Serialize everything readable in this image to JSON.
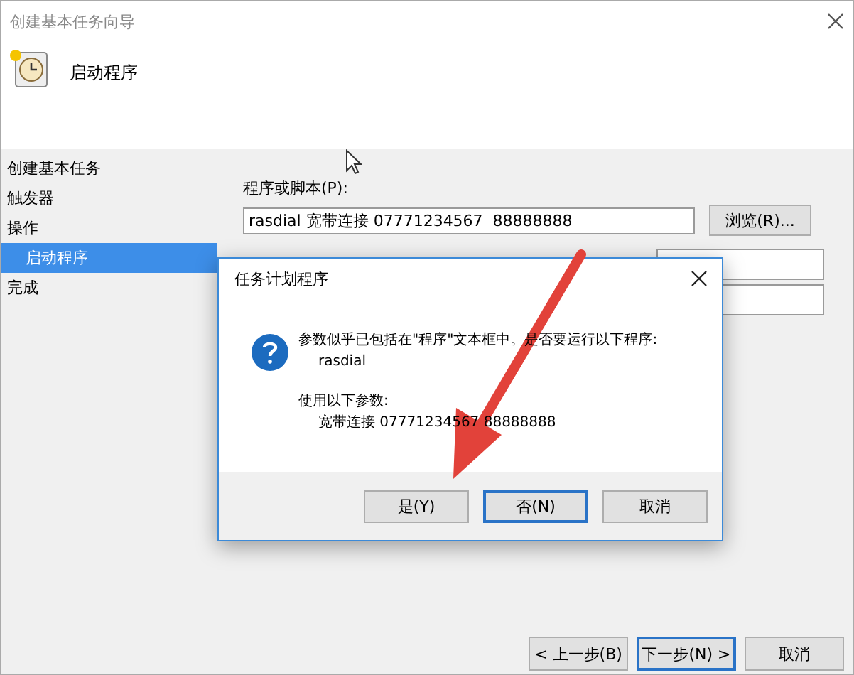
{
  "window": {
    "title": "创建基本任务向导",
    "heading": "启动程序"
  },
  "sidebar": {
    "items": [
      {
        "label": "创建基本任务",
        "selected": false
      },
      {
        "label": "触发器",
        "selected": false
      },
      {
        "label": "操作",
        "selected": false,
        "children": [
          {
            "label": "启动程序",
            "selected": true
          }
        ]
      },
      {
        "label": "完成",
        "selected": false
      }
    ]
  },
  "form": {
    "program_label": "程序或脚本(P):",
    "program_value": "rasdial 宽带连接 07771234567  88888888",
    "browse_button": "浏览(R)..."
  },
  "footer_buttons": [
    {
      "label": "< 上一步(B)",
      "default": false
    },
    {
      "label": "下一步(N) >",
      "default": true
    },
    {
      "label": "取消",
      "default": false
    }
  ],
  "dialog": {
    "title": "任务计划程序",
    "message": "参数似乎已包括在\"程序\"文本框中。是否要运行以下程序:",
    "program": "rasdial",
    "args_label": "使用以下参数:",
    "args": "宽带连接 07771234567  88888888",
    "buttons": [
      {
        "label": "是(Y)",
        "default": false
      },
      {
        "label": "否(N)",
        "default": true
      },
      {
        "label": "取消",
        "default": false
      }
    ]
  }
}
